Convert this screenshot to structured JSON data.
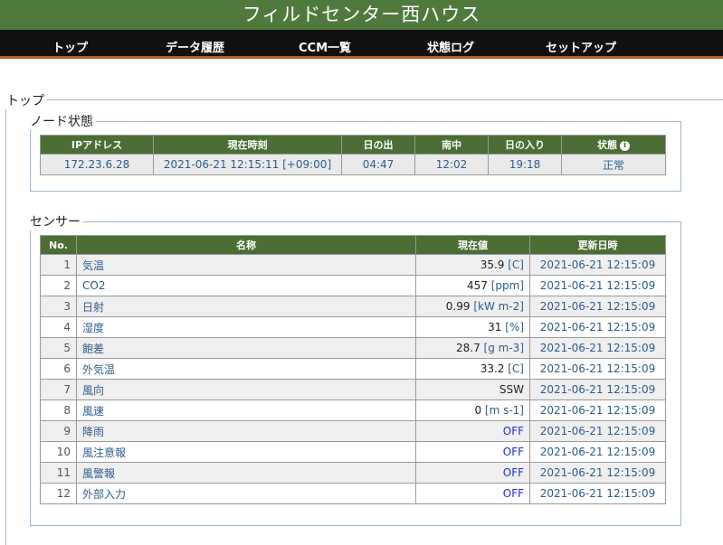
{
  "header": {
    "title": "フィルドセンター西ハウス"
  },
  "nav": {
    "items": [
      {
        "label": "トップ"
      },
      {
        "label": "データ履歴"
      },
      {
        "label": "CCM一覧"
      },
      {
        "label": "状態ログ"
      },
      {
        "label": "セットアップ"
      }
    ]
  },
  "top_section": {
    "legend": "トップ"
  },
  "node_status": {
    "legend": "ノード状態",
    "columns": [
      "IPアドレス",
      "現在時刻",
      "日の出",
      "南中",
      "日の入り",
      "状態"
    ],
    "row": {
      "ip": "172.23.6.28",
      "time": "2021-06-21 12:15:11 [+09:00]",
      "sunrise": "04:47",
      "noon": "12:02",
      "sunset": "19:18",
      "status": "正常"
    }
  },
  "sensors": {
    "legend": "センサー",
    "columns": [
      "No.",
      "名称",
      "現在値",
      "更新日時"
    ],
    "rows": [
      {
        "no": "1",
        "name": "気温",
        "value": "35.9",
        "unit": "[C]",
        "updated": "2021-06-21 12:15:09"
      },
      {
        "no": "2",
        "name": "CO2",
        "value": "457",
        "unit": "[ppm]",
        "updated": "2021-06-21 12:15:09"
      },
      {
        "no": "3",
        "name": "日射",
        "value": "0.99",
        "unit": "[kW m-2]",
        "updated": "2021-06-21 12:15:09"
      },
      {
        "no": "4",
        "name": "湿度",
        "value": "31",
        "unit": "[%]",
        "updated": "2021-06-21 12:15:09"
      },
      {
        "no": "5",
        "name": "飽差",
        "value": "28.7",
        "unit": "[g m-3]",
        "updated": "2021-06-21 12:15:09"
      },
      {
        "no": "6",
        "name": "外気温",
        "value": "33.2",
        "unit": "[C]",
        "updated": "2021-06-21 12:15:09"
      },
      {
        "no": "7",
        "name": "風向",
        "value": "SSW",
        "unit": "",
        "updated": "2021-06-21 12:15:09"
      },
      {
        "no": "8",
        "name": "風速",
        "value": "0",
        "unit": "[m s-1]",
        "updated": "2021-06-21 12:15:09"
      },
      {
        "no": "9",
        "name": "降雨",
        "value": "OFF",
        "unit": "",
        "updated": "2021-06-21 12:15:09"
      },
      {
        "no": "10",
        "name": "風注意報",
        "value": "OFF",
        "unit": "",
        "updated": "2021-06-21 12:15:09"
      },
      {
        "no": "11",
        "name": "風警報",
        "value": "OFF",
        "unit": "",
        "updated": "2021-06-21 12:15:09"
      },
      {
        "no": "12",
        "name": "外部入力",
        "value": "OFF",
        "unit": "",
        "updated": "2021-06-21 12:15:09"
      }
    ]
  }
}
